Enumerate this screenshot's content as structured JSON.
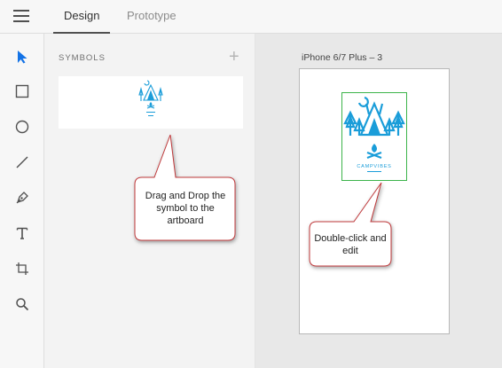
{
  "header": {
    "tabs": [
      {
        "label": "Design",
        "active": true
      },
      {
        "label": "Prototype",
        "active": false
      }
    ]
  },
  "tools": [
    "select-tool",
    "rectangle-tool",
    "ellipse-tool",
    "line-tool",
    "pen-tool",
    "text-tool",
    "artboard-tool",
    "zoom-tool"
  ],
  "symbols_panel": {
    "title": "SYMBOLS",
    "add_icon": "plus-icon"
  },
  "artboard": {
    "label": "iPhone 6/7 Plus – 3"
  },
  "symbol": {
    "text": "CAMPVIBES"
  },
  "callouts": {
    "drag": "Drag and Drop the symbol to the artboard",
    "edit": "Double-click and edit"
  },
  "colors": {
    "accent": "#1a9dd9",
    "selection": "#3cb44a",
    "callout_border": "#c0393b"
  }
}
